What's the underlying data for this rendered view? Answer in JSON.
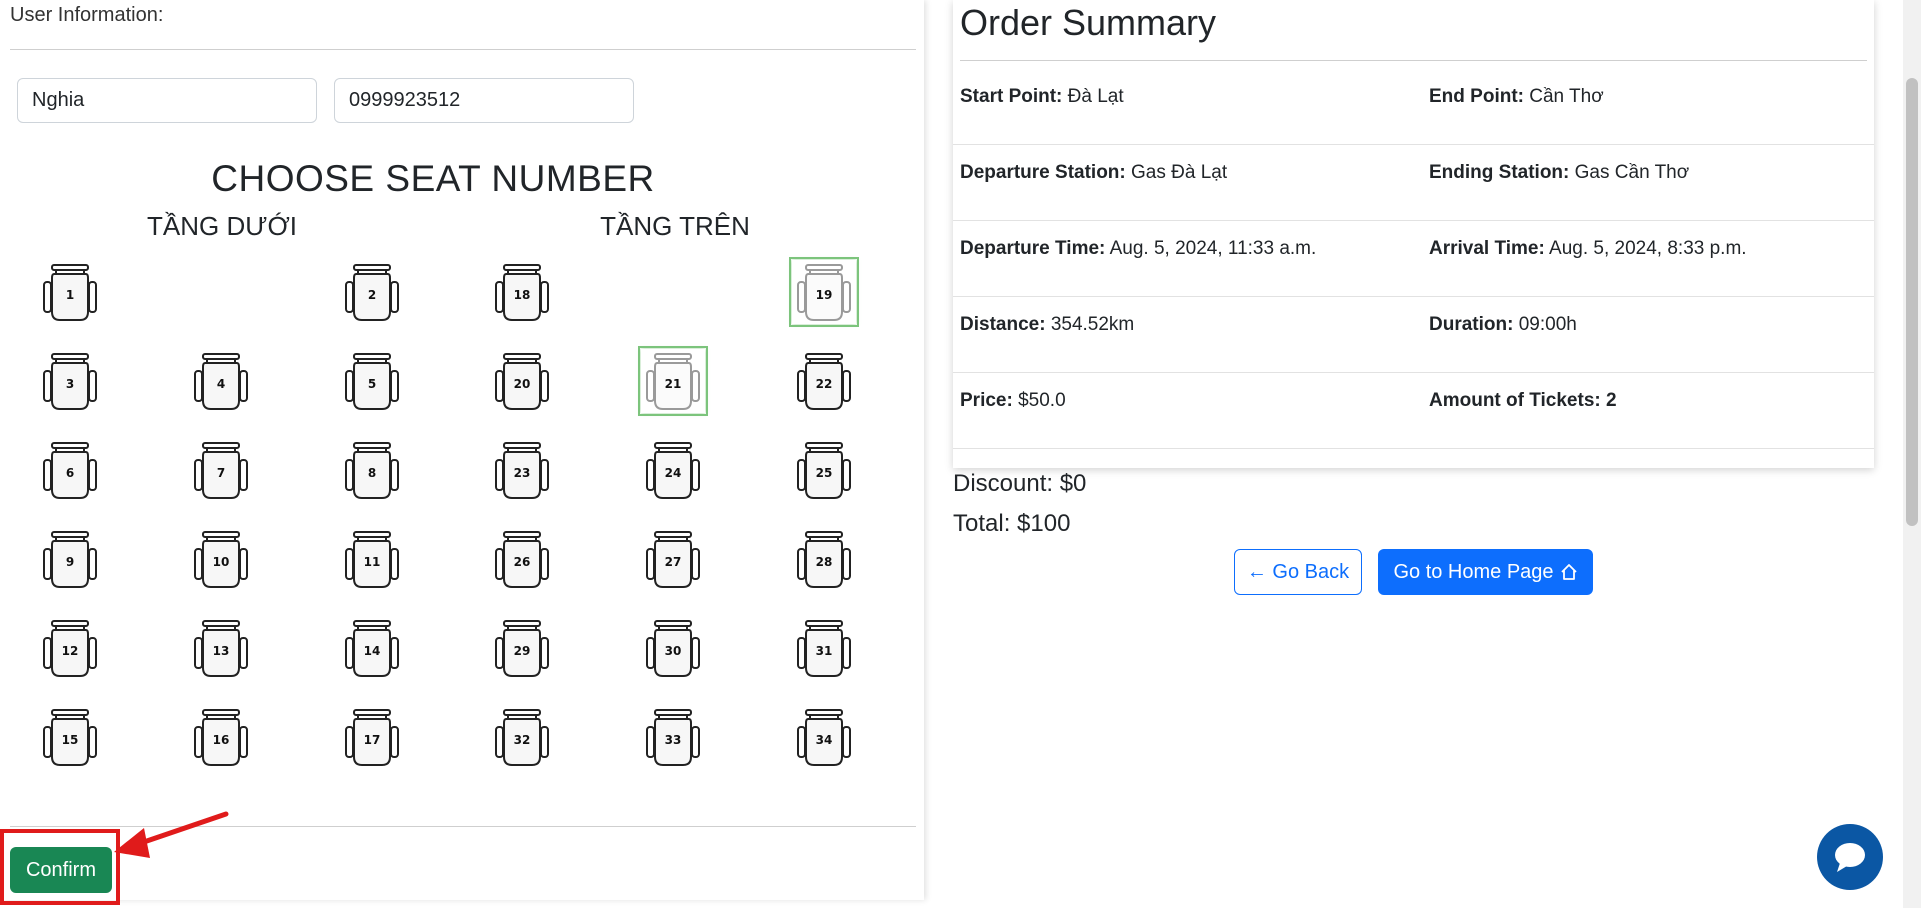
{
  "user_info": {
    "label": "User Information:",
    "name_value": "Nghia",
    "phone_value": "0999923512"
  },
  "seat_section": {
    "title": "CHOOSE SEAT NUMBER",
    "lower_deck_label": "TẦNG DƯỚI",
    "upper_deck_label": "TẦNG TRÊN",
    "lower_rows": [
      [
        "1",
        "",
        "2"
      ],
      [
        "3",
        "4",
        "5"
      ],
      [
        "6",
        "7",
        "8"
      ],
      [
        "9",
        "10",
        "11"
      ],
      [
        "12",
        "13",
        "14"
      ],
      [
        "15",
        "16",
        "17"
      ]
    ],
    "upper_rows": [
      [
        "18",
        "",
        "19"
      ],
      [
        "20",
        "21",
        "22"
      ],
      [
        "23",
        "24",
        "25"
      ],
      [
        "26",
        "27",
        "28"
      ],
      [
        "29",
        "30",
        "31"
      ],
      [
        "32",
        "33",
        "34"
      ]
    ],
    "selected_seats": [
      "19",
      "21"
    ]
  },
  "confirm_label": "Confirm",
  "order_summary": {
    "title": "Order Summary",
    "start_point_label": "Start Point:",
    "start_point": "Đà Lạt",
    "end_point_label": "End Point:",
    "end_point": "Cần Thơ",
    "departure_station_label": "Departure Station:",
    "departure_station": "Gas Đà Lạt",
    "ending_station_label": "Ending Station:",
    "ending_station": "Gas Cần Thơ",
    "departure_time_label": "Departure Time:",
    "departure_time": "Aug. 5, 2024, 11:33 a.m.",
    "arrival_time_label": "Arrival Time:",
    "arrival_time": "Aug. 5, 2024, 8:33 p.m.",
    "distance_label": "Distance:",
    "distance": "354.52km",
    "duration_label": "Duration:",
    "duration": "09:00h",
    "price_label": "Price:",
    "price": "$50.0",
    "tickets_label": "Amount of Tickets: 2"
  },
  "totals": {
    "discount": "Discount: $0",
    "total": "Total: $100"
  },
  "buttons": {
    "go_back": "← Go Back",
    "home": "Go to Home Page"
  }
}
